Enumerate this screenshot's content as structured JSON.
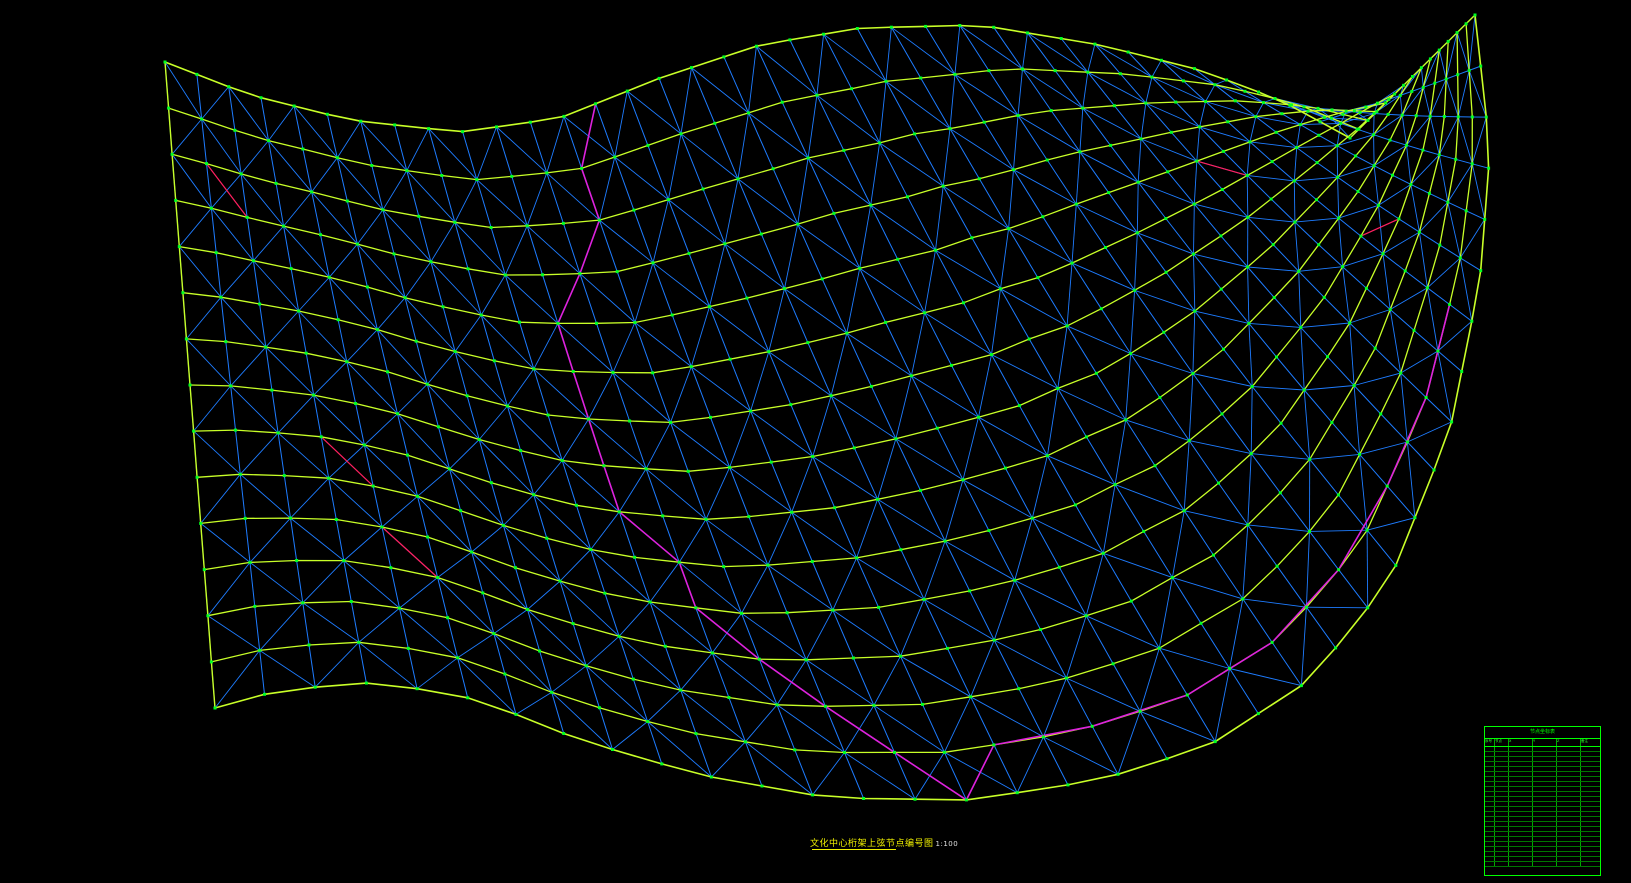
{
  "drawing": {
    "caption": "文化中心桁架上弦节点编号图",
    "caption_scale": "1:100",
    "colors": {
      "background": "#000000",
      "chord": "#c8ff28",
      "web": "#1e7cff",
      "node_label": "#00ff22",
      "boundary": "#dd22dd",
      "highlight": "#ff2060",
      "table_border": "#00ff00"
    }
  },
  "table": {
    "title": "节点坐标表",
    "columns": [
      "序号",
      "节点",
      "X",
      "Y",
      "Z",
      "备注"
    ],
    "row_count": 24
  }
}
